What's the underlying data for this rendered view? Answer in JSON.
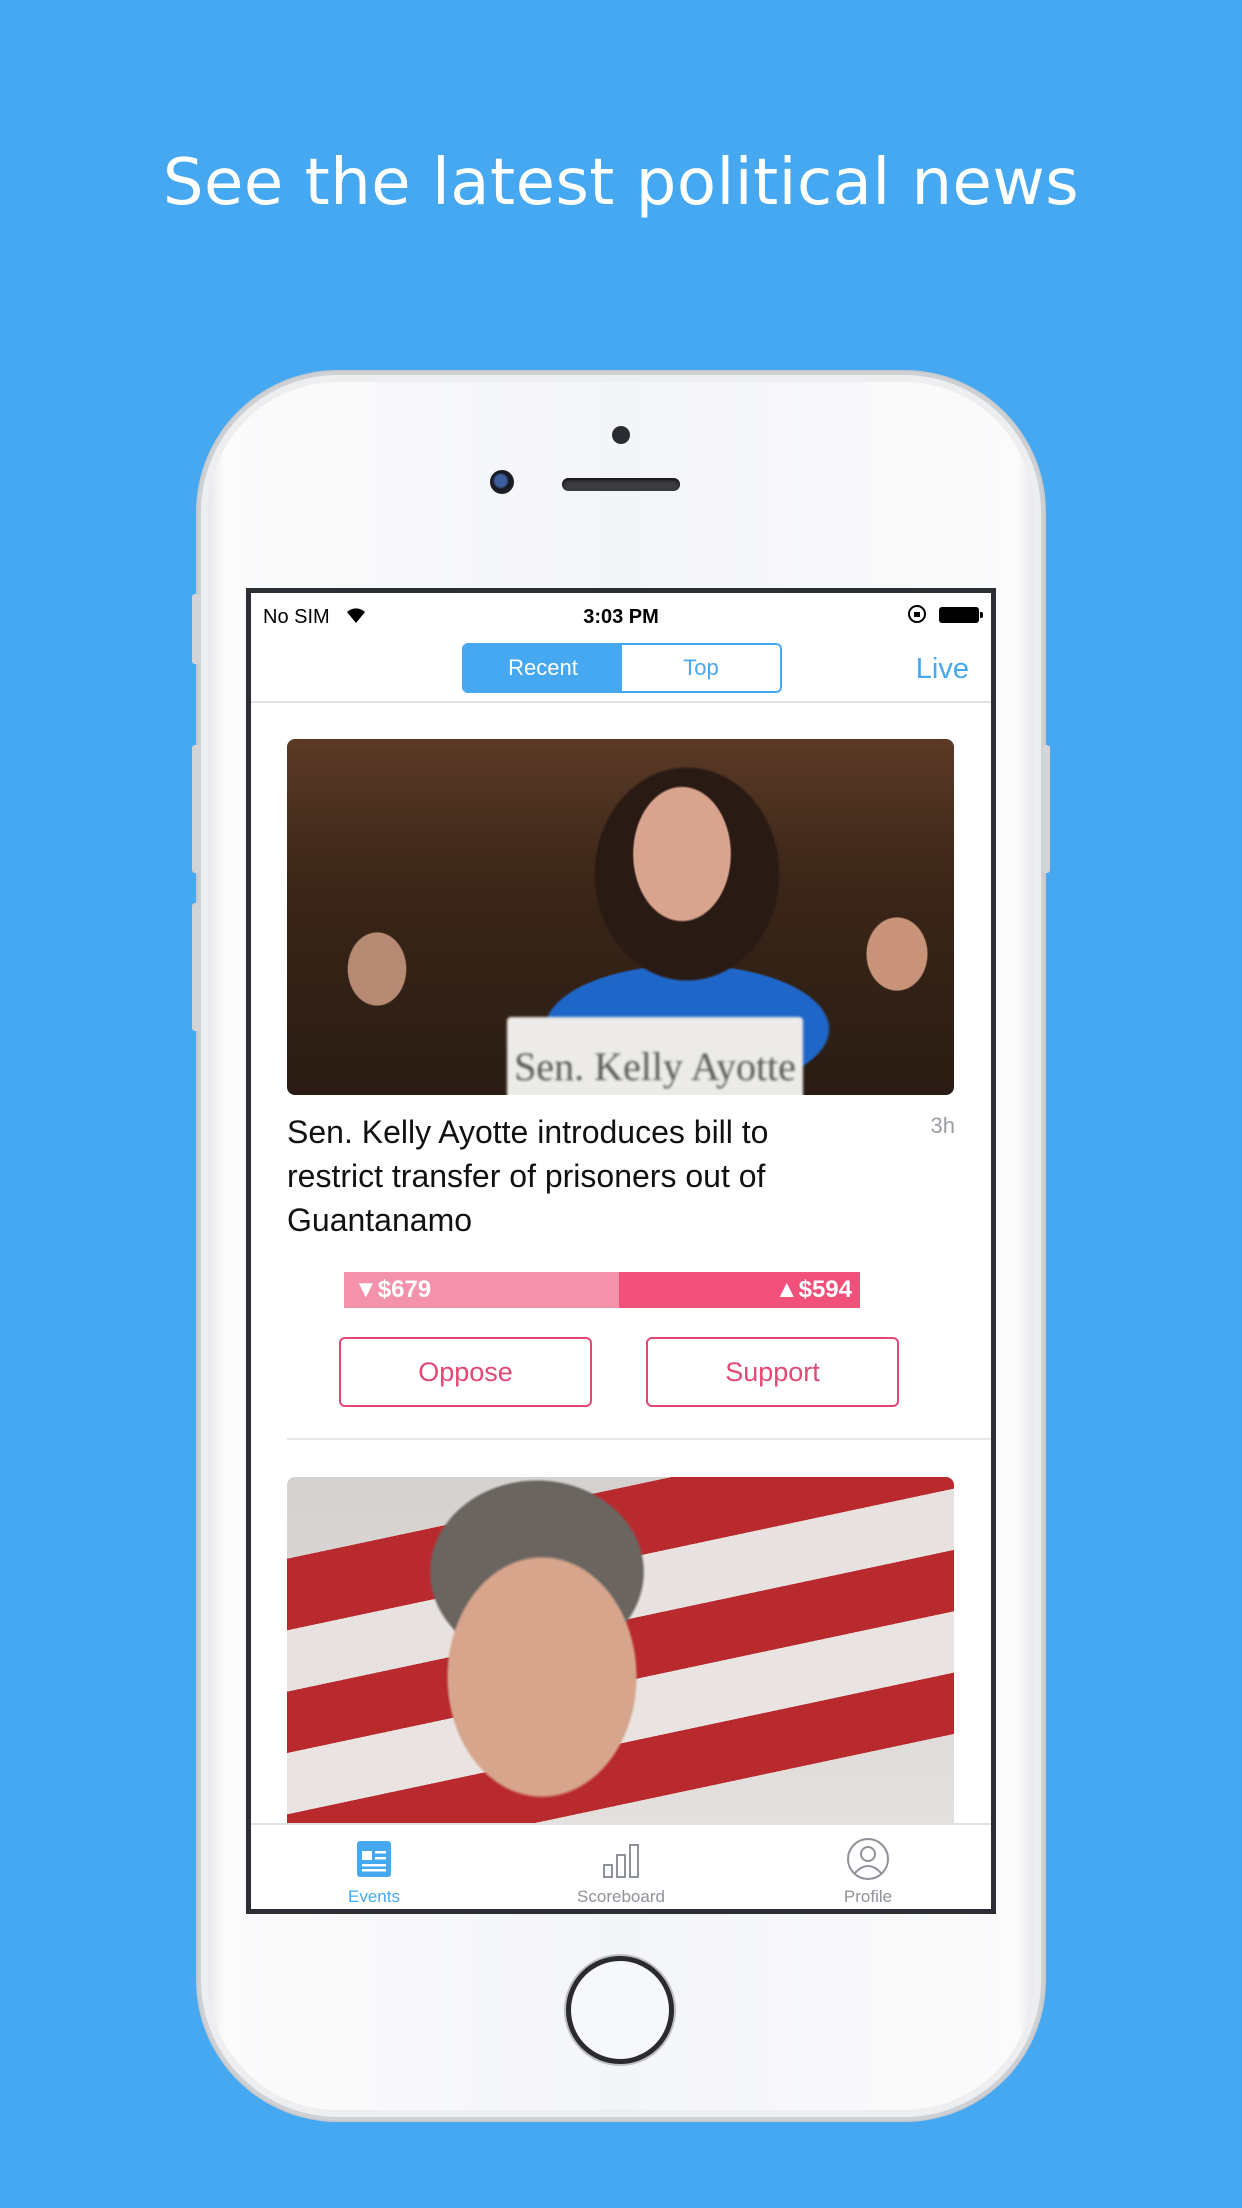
{
  "marketing": {
    "headline": "See the latest political news"
  },
  "status_bar": {
    "carrier": "No SIM",
    "time": "3:03 PM"
  },
  "nav": {
    "segments": [
      "Recent",
      "Top"
    ],
    "selected_segment": "Recent",
    "live_label": "Live"
  },
  "feed": {
    "items": [
      {
        "image_caption_text": "Sen. Kelly Ayotte",
        "title": "Sen. Kelly Ayotte introduces bill to restrict transfer of prisoners out of Guantanamo",
        "age": "3h",
        "oppose_amount": "$679",
        "support_amount": "$594",
        "oppose_share": 0.533,
        "oppose_label": "Oppose",
        "support_label": "Support"
      }
    ]
  },
  "tabbar": {
    "tabs": [
      {
        "label": "Events",
        "icon": "newspaper-icon",
        "active": true
      },
      {
        "label": "Scoreboard",
        "icon": "bar-chart-icon",
        "active": false
      },
      {
        "label": "Profile",
        "icon": "person-icon",
        "active": false
      }
    ]
  },
  "colors": {
    "background": "#45a8f0",
    "accent_blue": "#45a8f0",
    "oppose_pink": "#f592ab",
    "support_pink": "#f05079",
    "button_pink": "#e34874"
  }
}
